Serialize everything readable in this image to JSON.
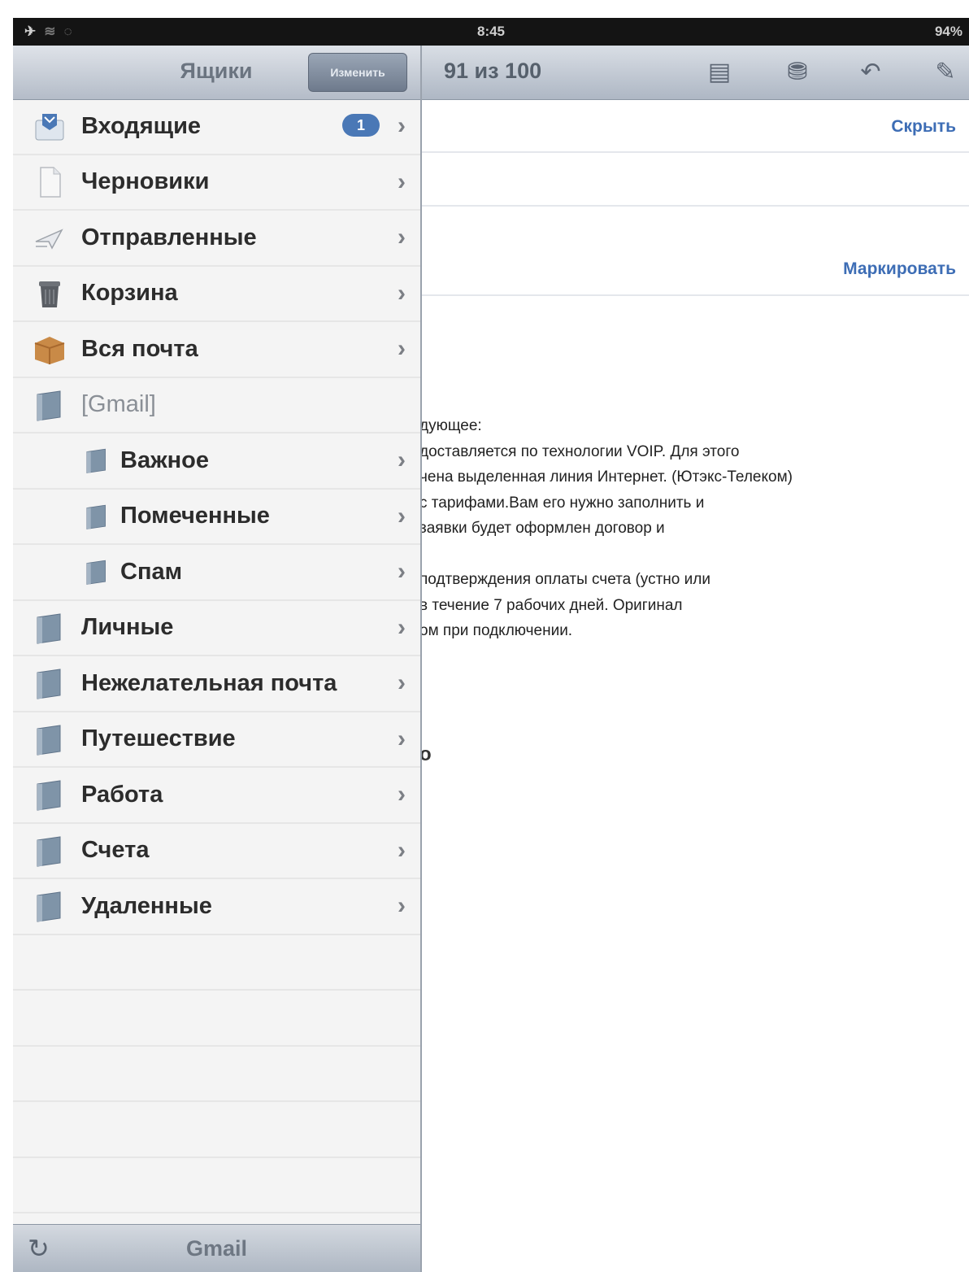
{
  "status_bar": {
    "time": "8:45",
    "battery": "94%"
  },
  "content": {
    "counter": "91 из 100",
    "hide_link": "Скрыть",
    "mark_link": "Маркировать",
    "body_lines": [
      "дующее:",
      "доставляется по технологии VOIP. Для этого",
      "чена выделенная линия Интернет. (Ютэкс-Телеком)",
      "с тарифами.Вам его нужно заполнить и",
      "заявки будет оформлен договор и",
      "",
      "подтверждения оплаты счета (устно или",
      "в течение 7 рабочих дней. Оригинал",
      "ом при подключении."
    ],
    "stray_char": "о"
  },
  "panel": {
    "title": "Ящики",
    "edit_label": "Изменить",
    "items": [
      {
        "label": "Входящие",
        "icon": "inbox-icon",
        "badge": "1"
      },
      {
        "label": "Черновики",
        "icon": "drafts-icon"
      },
      {
        "label": "Отправленные",
        "icon": "sent-icon"
      },
      {
        "label": "Корзина",
        "icon": "trash-icon"
      },
      {
        "label": "Вся почта",
        "icon": "all-mail-icon"
      },
      {
        "label": "[Gmail]",
        "icon": "folder-icon"
      },
      {
        "label": "Важное",
        "icon": "folder-icon"
      },
      {
        "label": "Помеченные",
        "icon": "folder-icon"
      },
      {
        "label": "Спам",
        "icon": "folder-icon"
      },
      {
        "label": "Личные",
        "icon": "folder-icon"
      },
      {
        "label": "Нежелательная почта",
        "icon": "folder-icon"
      },
      {
        "label": "Путешествие",
        "icon": "folder-icon"
      },
      {
        "label": "Работа",
        "icon": "folder-icon"
      },
      {
        "label": "Счета",
        "icon": "folder-icon"
      },
      {
        "label": "Удаленные",
        "icon": "folder-icon"
      }
    ],
    "footer_title": "Gmail"
  },
  "colors": {
    "accent": "#3d6db5",
    "badge": "#4a78b6",
    "status_bar": "#141414"
  }
}
